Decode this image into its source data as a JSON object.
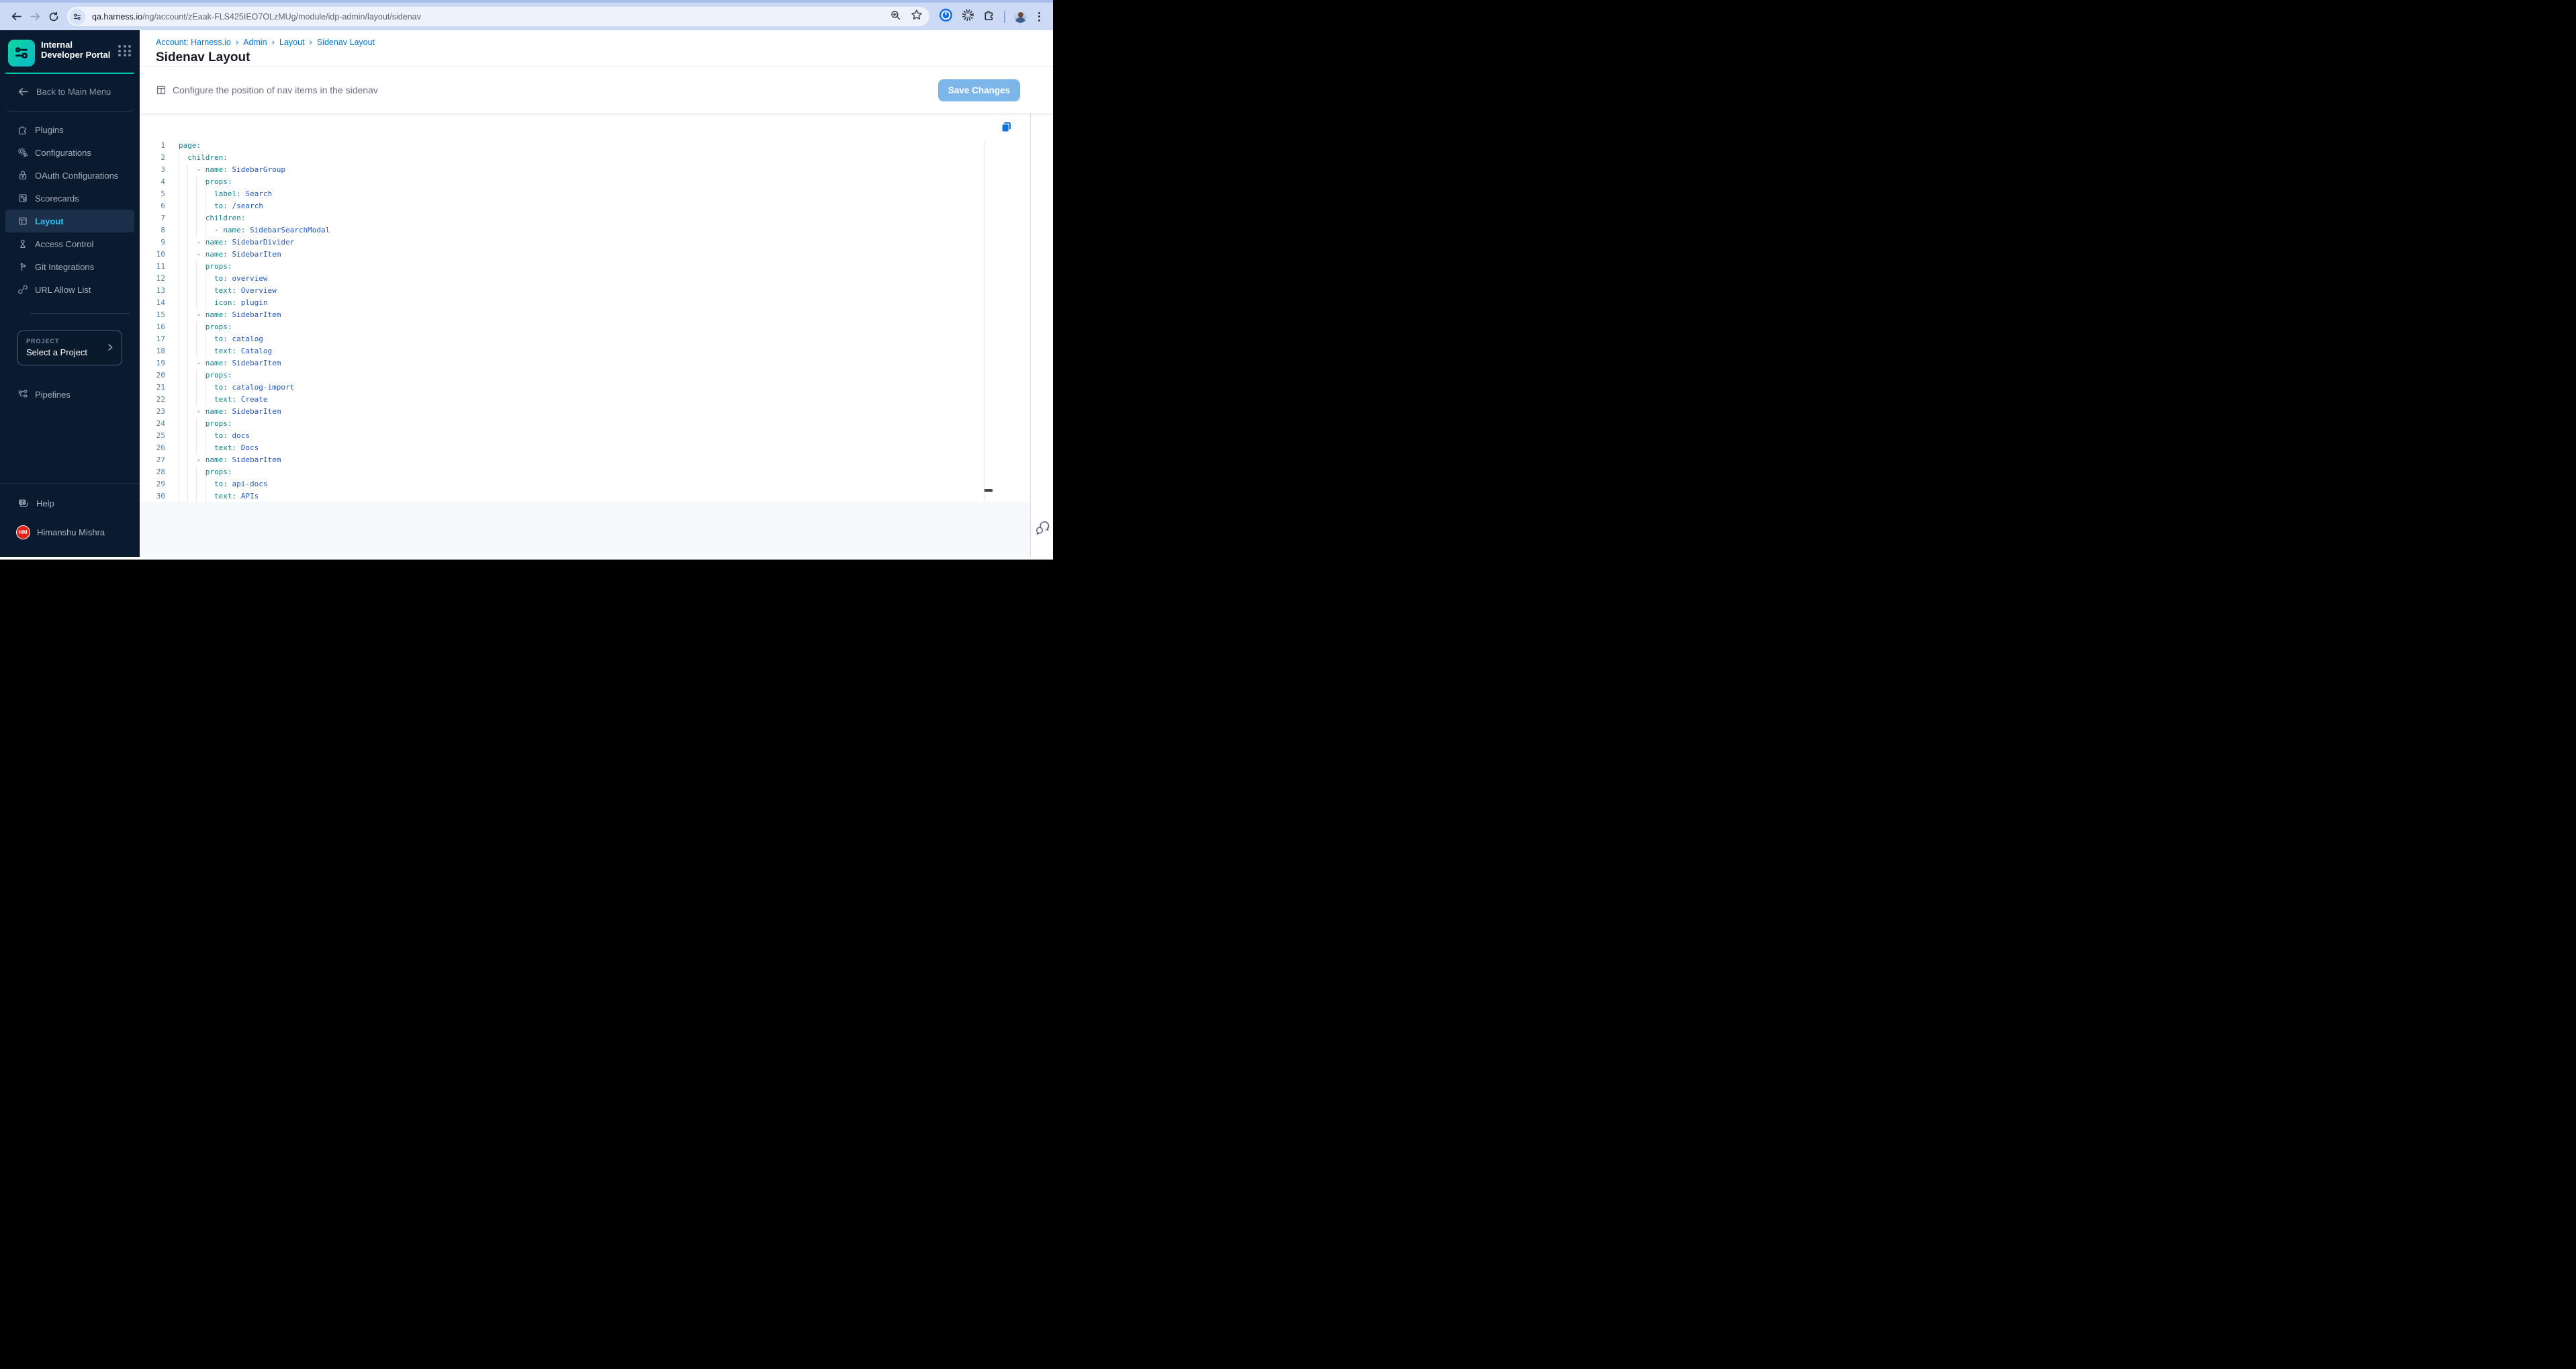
{
  "browser": {
    "url_domain": "qa.harness.io",
    "url_path": "/ng/account/zEaak-FLS425IEO7OLzMUg/module/idp-admin/layout/sidenav"
  },
  "sidebar": {
    "product_title": "Internal Developer Portal",
    "back_label": "Back to Main Menu",
    "items": [
      {
        "label": "Plugins"
      },
      {
        "label": "Configurations"
      },
      {
        "label": "OAuth Configurations"
      },
      {
        "label": "Scorecards"
      },
      {
        "label": "Layout",
        "selected": true
      },
      {
        "label": "Access Control"
      },
      {
        "label": "Git Integrations"
      },
      {
        "label": "URL Allow List"
      }
    ],
    "project": {
      "label": "PROJECT",
      "value": "Select a Project"
    },
    "pipelines_label": "Pipelines",
    "help_label": "Help",
    "user": {
      "initials": "HM",
      "name": "Himanshu Mishra"
    }
  },
  "header": {
    "breadcrumb": [
      "Account: Harness.io",
      "Admin",
      "Layout",
      "Sidenav Layout"
    ],
    "breadcrumb_sep": "›",
    "title": "Sidenav Layout"
  },
  "toolbar": {
    "description": "Configure the position of nav items in the sidenav",
    "save_label": "Save Changes"
  },
  "editor": {
    "lines": [
      {
        "n": 1,
        "indent": 0,
        "dash": false,
        "key": "page",
        "value": ""
      },
      {
        "n": 2,
        "indent": 2,
        "dash": false,
        "key": "children",
        "value": ""
      },
      {
        "n": 3,
        "indent": 4,
        "dash": true,
        "key": "name",
        "value": "SidebarGroup"
      },
      {
        "n": 4,
        "indent": 6,
        "dash": false,
        "key": "props",
        "value": ""
      },
      {
        "n": 5,
        "indent": 8,
        "dash": false,
        "key": "label",
        "value": "Search"
      },
      {
        "n": 6,
        "indent": 8,
        "dash": false,
        "key": "to",
        "value": "/search"
      },
      {
        "n": 7,
        "indent": 6,
        "dash": false,
        "key": "children",
        "value": ""
      },
      {
        "n": 8,
        "indent": 8,
        "dash": true,
        "key": "name",
        "value": "SidebarSearchModal"
      },
      {
        "n": 9,
        "indent": 4,
        "dash": true,
        "key": "name",
        "value": "SidebarDivider"
      },
      {
        "n": 10,
        "indent": 4,
        "dash": true,
        "key": "name",
        "value": "SidebarItem"
      },
      {
        "n": 11,
        "indent": 6,
        "dash": false,
        "key": "props",
        "value": ""
      },
      {
        "n": 12,
        "indent": 8,
        "dash": false,
        "key": "to",
        "value": "overview"
      },
      {
        "n": 13,
        "indent": 8,
        "dash": false,
        "key": "text",
        "value": "Overview"
      },
      {
        "n": 14,
        "indent": 8,
        "dash": false,
        "key": "icon",
        "value": "plugin"
      },
      {
        "n": 15,
        "indent": 4,
        "dash": true,
        "key": "name",
        "value": "SidebarItem"
      },
      {
        "n": 16,
        "indent": 6,
        "dash": false,
        "key": "props",
        "value": ""
      },
      {
        "n": 17,
        "indent": 8,
        "dash": false,
        "key": "to",
        "value": "catalog"
      },
      {
        "n": 18,
        "indent": 8,
        "dash": false,
        "key": "text",
        "value": "Catalog"
      },
      {
        "n": 19,
        "indent": 4,
        "dash": true,
        "key": "name",
        "value": "SidebarItem"
      },
      {
        "n": 20,
        "indent": 6,
        "dash": false,
        "key": "props",
        "value": ""
      },
      {
        "n": 21,
        "indent": 8,
        "dash": false,
        "key": "to",
        "value": "catalog-import"
      },
      {
        "n": 22,
        "indent": 8,
        "dash": false,
        "key": "text",
        "value": "Create"
      },
      {
        "n": 23,
        "indent": 4,
        "dash": true,
        "key": "name",
        "value": "SidebarItem"
      },
      {
        "n": 24,
        "indent": 6,
        "dash": false,
        "key": "props",
        "value": ""
      },
      {
        "n": 25,
        "indent": 8,
        "dash": false,
        "key": "to",
        "value": "docs"
      },
      {
        "n": 26,
        "indent": 8,
        "dash": false,
        "key": "text",
        "value": "Docs"
      },
      {
        "n": 27,
        "indent": 4,
        "dash": true,
        "key": "name",
        "value": "SidebarItem"
      },
      {
        "n": 28,
        "indent": 6,
        "dash": false,
        "key": "props",
        "value": ""
      },
      {
        "n": 29,
        "indent": 8,
        "dash": false,
        "key": "to",
        "value": "api-docs"
      },
      {
        "n": 30,
        "indent": 8,
        "dash": false,
        "key": "text",
        "value": "APIs"
      }
    ]
  },
  "colors": {
    "accent": "#0278d5",
    "save-btn": "#7db7ea",
    "sidebar-bg": "#0a1b2f",
    "sidebar-selected-bg": "#1c2f4a",
    "sidebar-selected-text": "#29c1f2",
    "teal-line": "#00c3ab",
    "avatar-red": "#e1251b",
    "yaml-key": "#11808c",
    "yaml-value": "#2257c4",
    "yaml-dash": "#52606d",
    "line-number": "#567d9e",
    "copy-icon": "#1173d8"
  }
}
